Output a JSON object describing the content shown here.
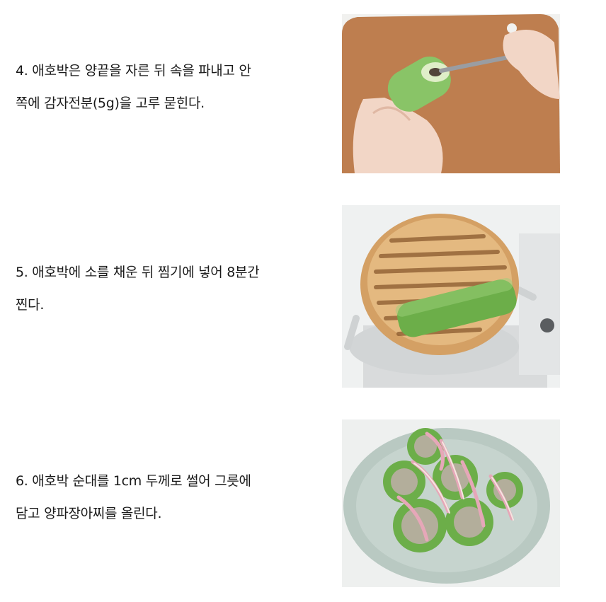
{
  "steps": [
    {
      "line1": "4. 애호박은 양끝을 자른 뒤 속을 파내고 안",
      "line2": "쪽에 감자전분(5g)을 고루 묻힌다.",
      "photo_icon": "zucchini-hollowing-photo"
    },
    {
      "line1": "5. 애호박에 소를 채운 뒤 찜기에 넣어 8분간",
      "line2": "찐다.",
      "photo_icon": "zucchini-steamer-photo"
    },
    {
      "line1": "6. 애호박 순대를 1cm 두께로 썰어 그릇에",
      "line2": "담고 양파장아찌를 올린다.",
      "photo_icon": "zucchini-plate-photo"
    }
  ]
}
